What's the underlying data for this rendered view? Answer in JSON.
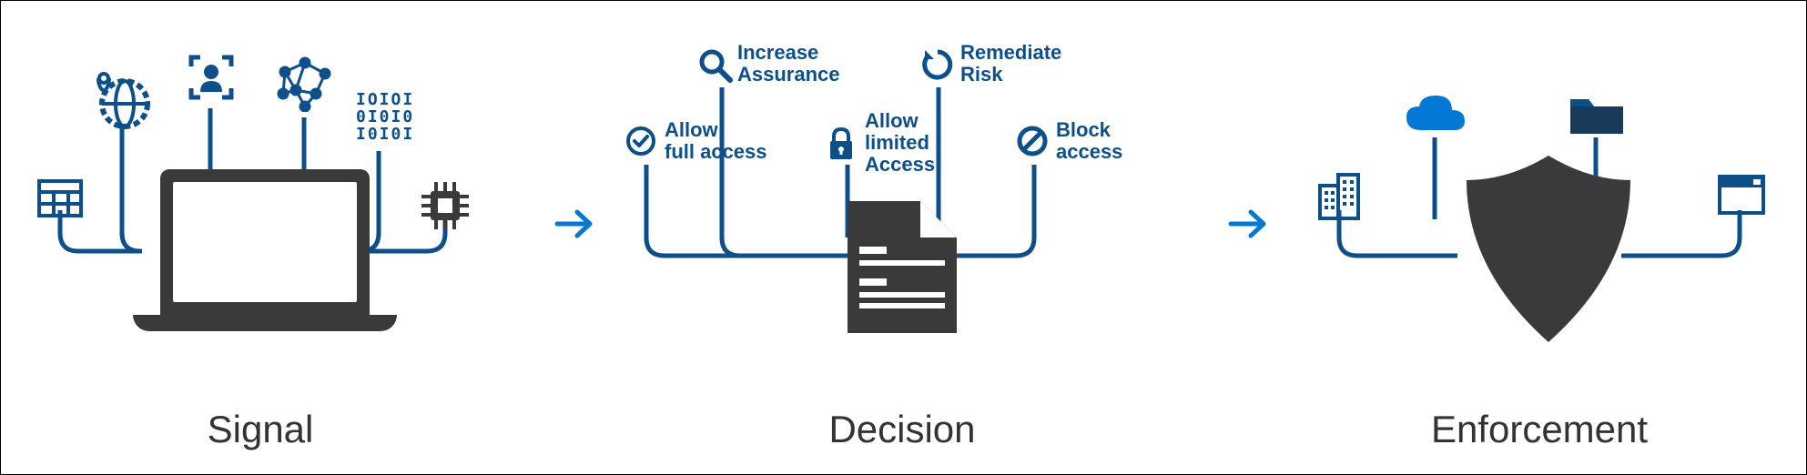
{
  "stages": {
    "signal": {
      "title": "Signal"
    },
    "decision": {
      "title": "Decision",
      "items": {
        "allow_full": "Allow\nfull access",
        "increase_assurance": "Increase\nAssurance",
        "allow_limited": "Allow\nlimited\nAccess",
        "remediate_risk": "Remediate\nRisk",
        "block_access": "Block\naccess"
      }
    },
    "enforcement": {
      "title": "Enforcement"
    }
  },
  "signal_icons": {
    "calendar": "calendar-grid-icon",
    "globe": "globe-location-icon",
    "user": "user-focus-icon",
    "network": "network-graph-icon",
    "binary": "binary-data-icon",
    "chip": "chip-icon"
  },
  "enforcement_icons": {
    "building": "building-icon",
    "cloud": "cloud-icon",
    "folder": "folder-icon",
    "browser": "browser-window-icon"
  },
  "colors": {
    "blue": "#0d4f8b",
    "lightblue": "#0078d4",
    "dark": "#3a3a3a"
  },
  "binary_text": "IOIOI\n0I0I0\nI0I0I"
}
